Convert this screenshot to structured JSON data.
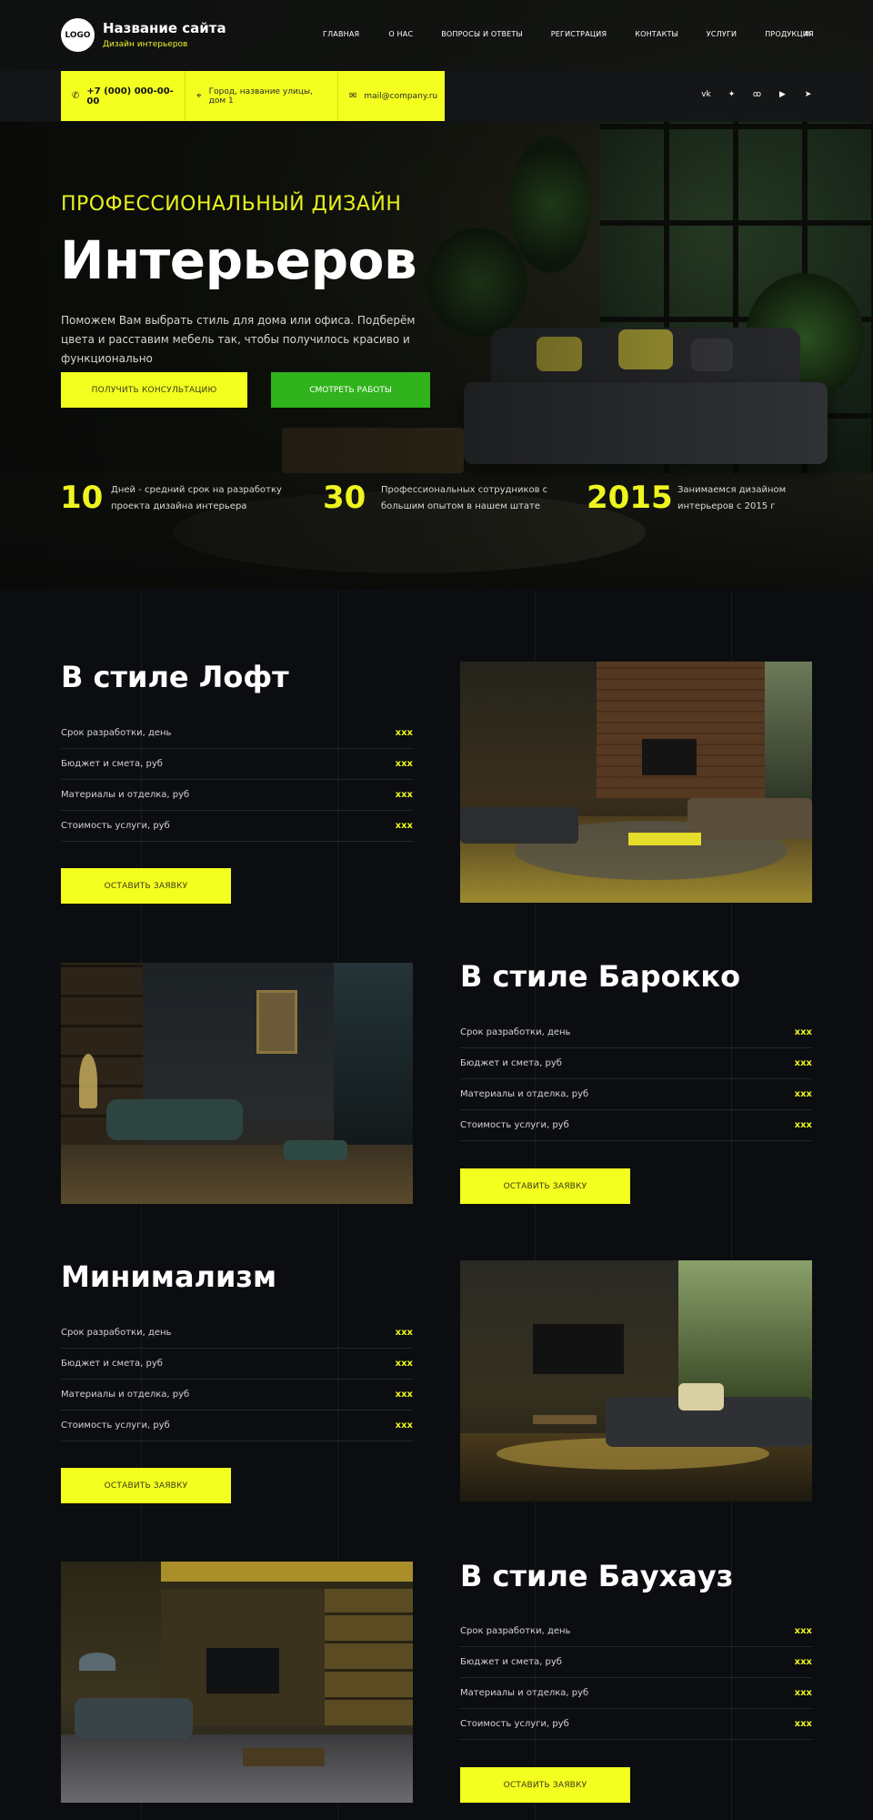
{
  "header": {
    "logo": "LOGO",
    "site_title": "Название сайта",
    "site_subtitle": "Дизайн интерьеров",
    "nav": [
      "ГЛАВНАЯ",
      "О НАС",
      "ВОПРОСЫ И ОТВЕТЫ",
      "РЕГИСТРАЦИЯ",
      "КОНТАКТЫ",
      "УСЛУГИ",
      "ПРОДУКЦИЯ"
    ],
    "menu_icon": "≡"
  },
  "contacts": {
    "phone": "+7 (000) 000-00-00",
    "address": "Город, название улицы, дом 1",
    "email": "mail@company.ru"
  },
  "socials": [
    "vk-icon",
    "twitter-icon",
    "odnoklassniki-icon",
    "youtube-icon",
    "telegram-icon"
  ],
  "hero": {
    "eyebrow": "ПРОФЕССИОНАЛЬНЫЙ ДИЗАЙН",
    "title": "Интерьеров",
    "description": "Поможем Вам выбрать стиль для дома или офиса. Подберём цвета и расставим мебель так, чтобы получилось красиво и функционально",
    "btn_consult": "ПОЛУЧИТЬ КОНСУЛЬТАЦИЮ",
    "btn_works": "СМОТРЕТЬ РАБОТЫ"
  },
  "stats": [
    {
      "num": "10",
      "text": "Дней - средний срок на разработку проекта дизайна интерьера"
    },
    {
      "num": "30",
      "text": "Профессиональных сотрудников с большим опытом в нашем штате"
    },
    {
      "num": "2015",
      "text": "Занимаемся дизайном интерьеров с 2015 г"
    }
  ],
  "sections": [
    {
      "title": "В стиле Лофт"
    },
    {
      "title": "В стиле Барокко"
    },
    {
      "title": "Минимализм"
    },
    {
      "title": "В стиле Баухауз"
    }
  ],
  "rows": [
    {
      "label": "Срок разработки, день",
      "value": "xxx"
    },
    {
      "label": "Бюджет и смета, руб",
      "value": "xxx"
    },
    {
      "label": "Материалы и отделка, руб",
      "value": "xxx"
    },
    {
      "label": "Стоимость услуги, руб",
      "value": "xxx"
    }
  ],
  "cta": "ОСТАВИТЬ ЗАЯВКУ",
  "colors": {
    "accent": "#f3ff1f",
    "green": "#30b31c",
    "bg": "#0b0d10"
  }
}
